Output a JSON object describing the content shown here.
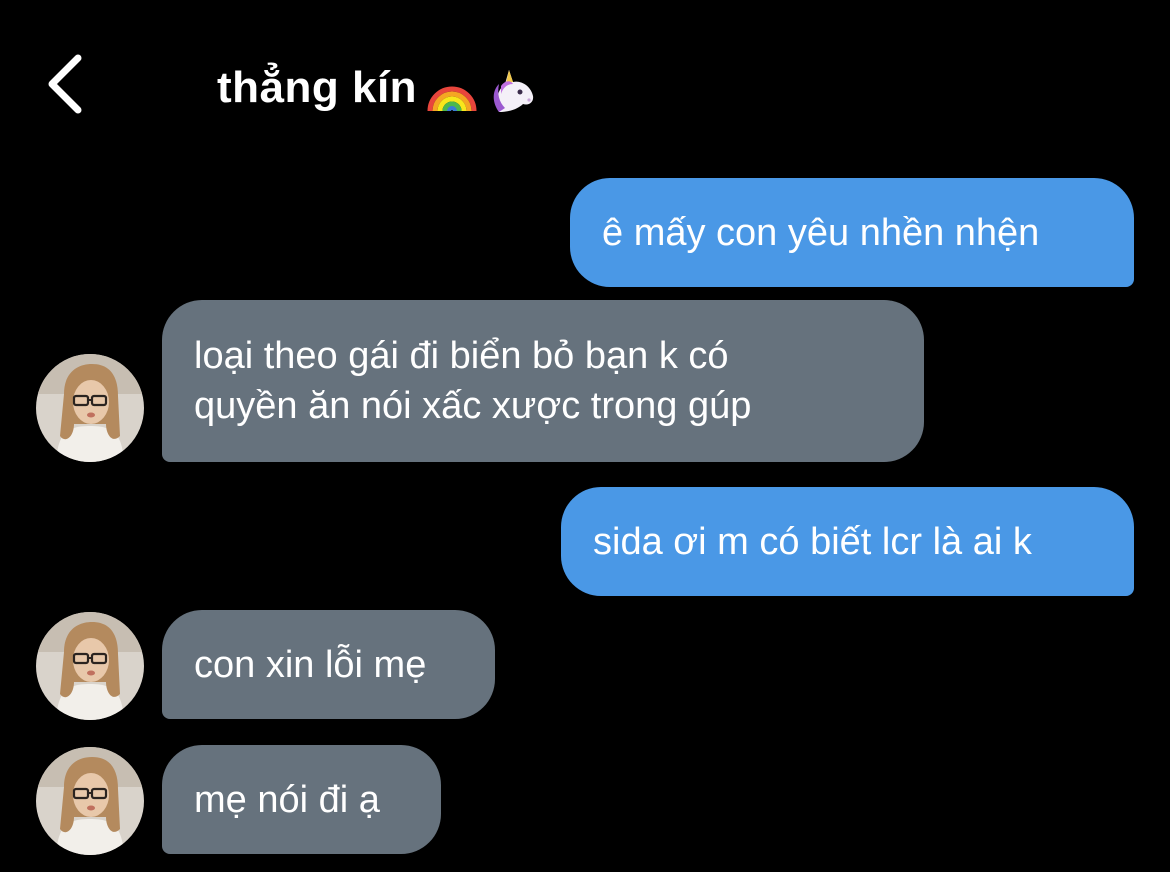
{
  "header": {
    "title": "thẳng kín",
    "title_emojis": [
      "rainbow-icon",
      "unicorn-icon"
    ],
    "back_icon": "chevron-left-icon"
  },
  "colors": {
    "background": "#000000",
    "outgoing_bubble": "#4a98e6",
    "incoming_bubble": "#66727d",
    "text": "#ffffff"
  },
  "messages": [
    {
      "direction": "outgoing",
      "text": "ê mấy con yêu nhền nhện"
    },
    {
      "direction": "incoming",
      "text": "loại theo gái đi biển bỏ bạn k có\nquyền ăn nói xấc xược trong gúp",
      "avatar": true
    },
    {
      "direction": "outgoing",
      "text": "sida ơi m có biết lcr là ai k"
    },
    {
      "direction": "incoming",
      "text": "con xin lỗi mẹ",
      "avatar": true
    },
    {
      "direction": "incoming",
      "text": "mẹ nói đi ạ",
      "avatar": true
    }
  ]
}
